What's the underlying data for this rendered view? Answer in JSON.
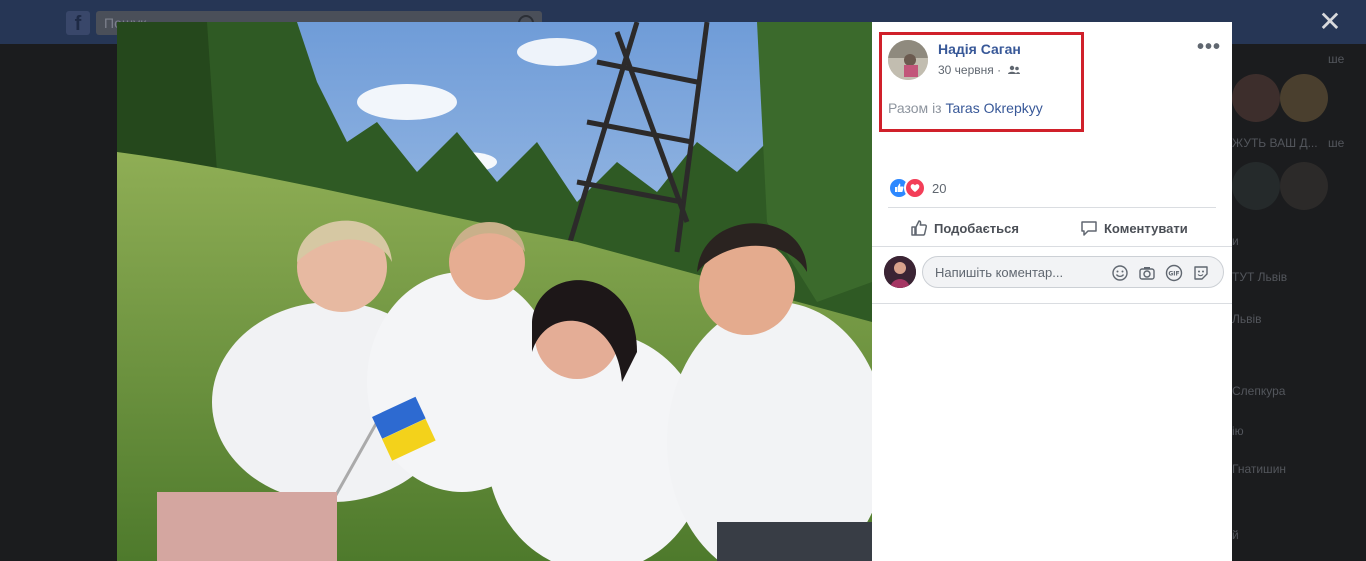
{
  "underlay": {
    "search_placeholder": "Пошук",
    "right_column": [
      {
        "text": "ше"
      },
      {
        "text": "ЖУТЬ ВАШ Д..."
      },
      {
        "text": "ше"
      },
      {
        "text": "и"
      },
      {
        "text": "ТУТ Львів"
      },
      {
        "text": "Львів"
      },
      {
        "text": "Слепкура"
      },
      {
        "text": "ію"
      },
      {
        "text": "Гнатишин"
      },
      {
        "text": "й"
      }
    ]
  },
  "lightbox": {
    "close_glyph": "✕"
  },
  "post": {
    "author": "Надія Саган",
    "date": "30 червня",
    "separator": " · ",
    "more_glyph": "•••",
    "tagged_prefix": "Разом із ",
    "tagged_name": "Taras Okrepkyy",
    "reaction_count": "20",
    "actions": {
      "like": "Подобається",
      "comment": "Коментувати"
    },
    "comment_placeholder": "Напишіть коментар...",
    "colors": {
      "link": "#385898",
      "highlight": "#d0202a",
      "like": "#2d88ff",
      "love": "#f33e58"
    }
  }
}
